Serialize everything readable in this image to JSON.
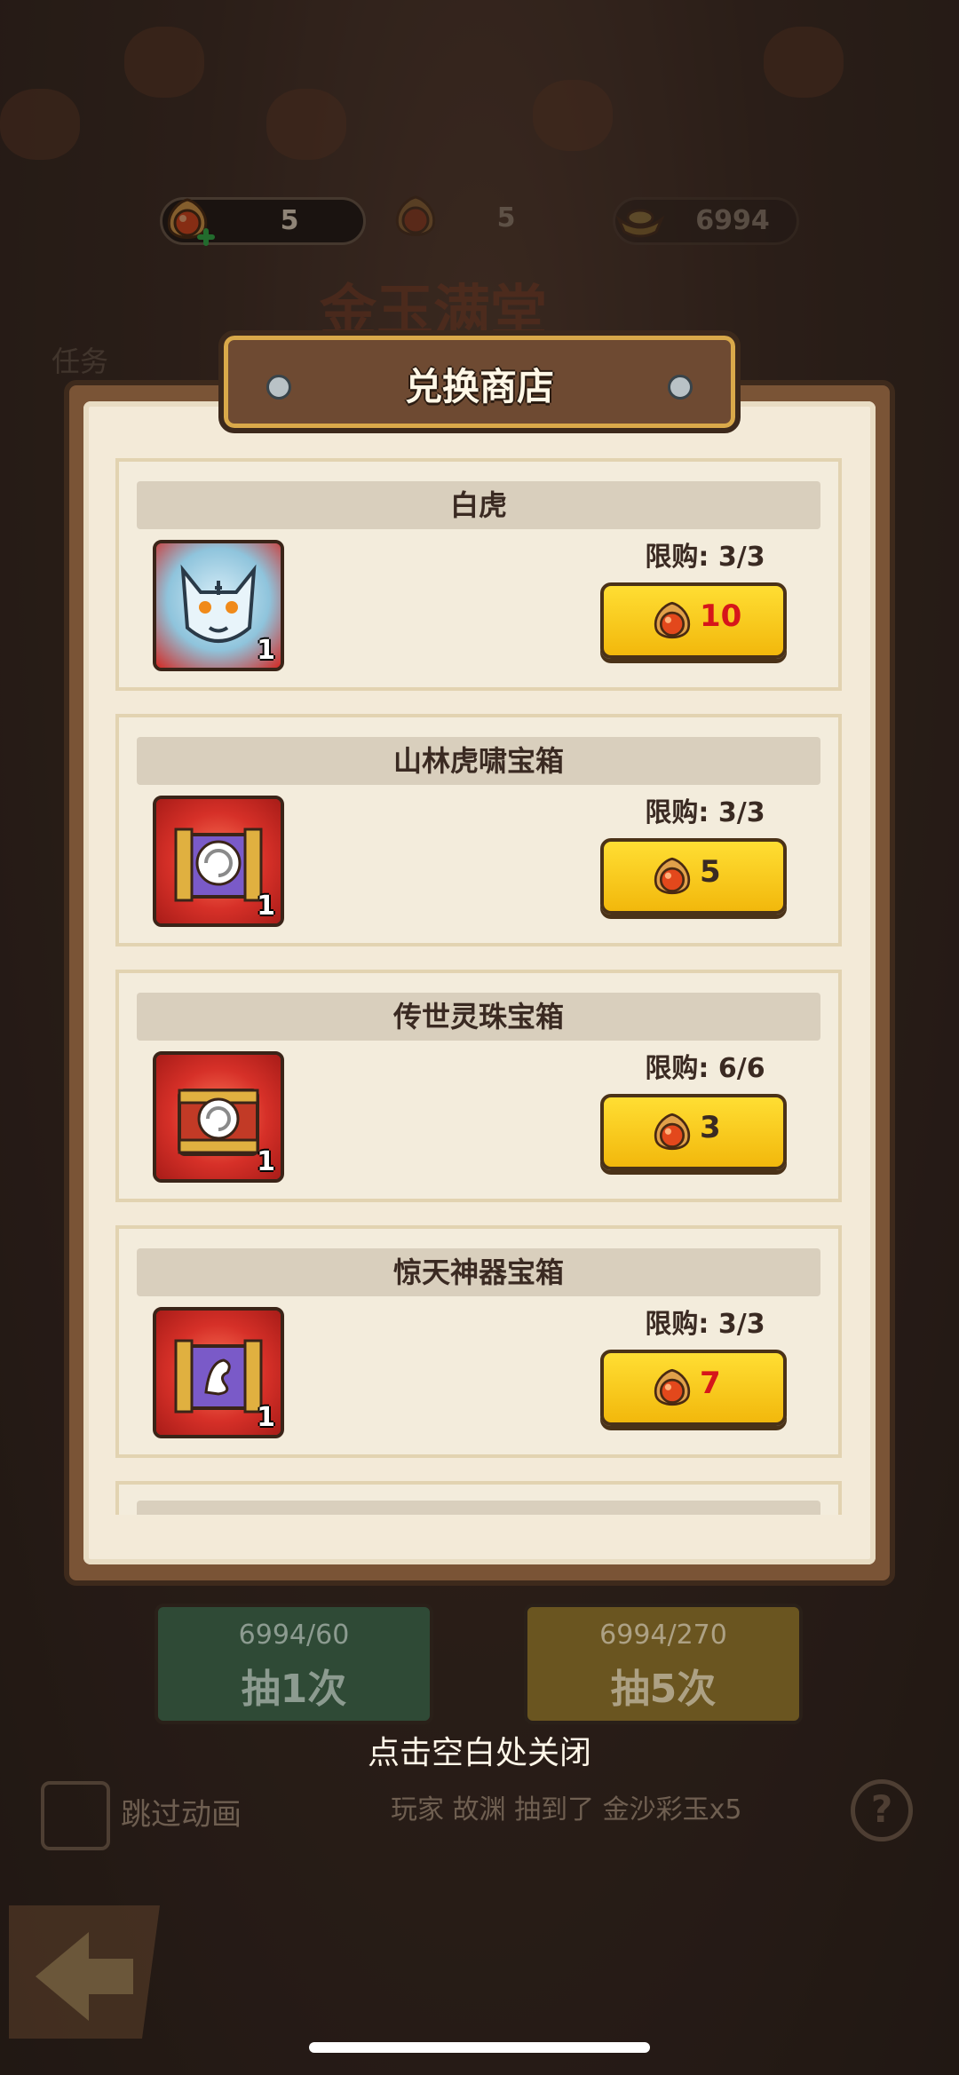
{
  "currency": [
    {
      "icon": "jade-gem-icon",
      "value": "5"
    },
    {
      "icon": "jade-gem-icon",
      "value": "5"
    },
    {
      "icon": "gold-ingot-icon",
      "value": "6994"
    }
  ],
  "background": {
    "task_label": "任务",
    "banner_title": "金玉满堂"
  },
  "dialog": {
    "title": "兑换商店",
    "items": [
      {
        "name": "白虎",
        "limit": "限购: 3/3",
        "price": "10",
        "count": "1",
        "icon": "white-tiger-icon"
      },
      {
        "name": "山林虎啸宝箱",
        "limit": "限购: 3/3",
        "price": "5",
        "count": "1",
        "icon": "purple-chest-icon"
      },
      {
        "name": "传世灵珠宝箱",
        "limit": "限购: 6/6",
        "price": "3",
        "count": "1",
        "icon": "gold-chest-icon"
      },
      {
        "name": "惊天神器宝箱",
        "limit": "限购: 3/3",
        "price": "7",
        "count": "1",
        "icon": "dragon-chest-icon"
      }
    ]
  },
  "draw": {
    "once_cost": "6994/60",
    "once_label": "抽1次",
    "five_cost": "6994/270",
    "five_label": "抽5次"
  },
  "close_hint": "点击空白处关闭",
  "skip_label": "跳过动画",
  "ticker": "玩家 故渊 抽到了 金沙彩玉x5",
  "colors": {
    "price_red": "#d6161a",
    "button_yellow": "#ffd21f",
    "frame_brown": "#7a5436",
    "paper": "#f3ead8"
  }
}
